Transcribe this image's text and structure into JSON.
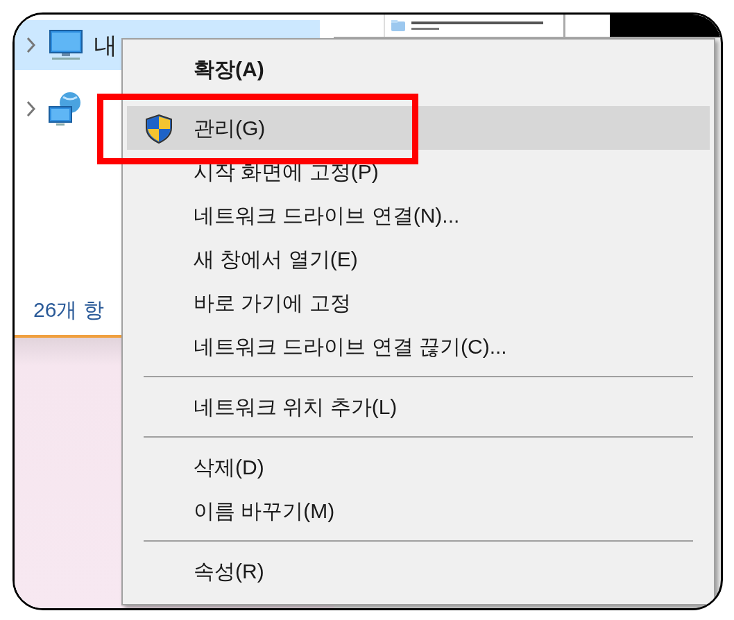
{
  "tree": [
    {
      "kind": "computer",
      "label": "내",
      "expanded": false,
      "selected": true
    },
    {
      "kind": "network",
      "expanded": false,
      "selected": false
    }
  ],
  "status_bar": "26개 항",
  "context_menu": [
    {
      "kind": "item",
      "label": "확장(A)",
      "default": true,
      "selected": false,
      "annotated": false
    },
    {
      "kind": "elevated",
      "label": "관리(G)",
      "default": false,
      "selected": true,
      "annotated": true
    },
    {
      "kind": "item",
      "label": "시작 화면에 고정(P)",
      "default": false,
      "selected": false,
      "annotated": false
    },
    {
      "kind": "item",
      "label": "네트워크 드라이브 연결(N)...",
      "default": false,
      "selected": false,
      "annotated": false
    },
    {
      "kind": "item",
      "label": "새 창에서 열기(E)",
      "default": false,
      "selected": false,
      "annotated": false
    },
    {
      "kind": "item",
      "label": "바로 가기에 고정",
      "default": false,
      "selected": false,
      "annotated": false
    },
    {
      "kind": "item",
      "label": "네트워크 드라이브 연결 끊기(C)...",
      "default": false,
      "selected": false,
      "annotated": false
    },
    {
      "kind": "separator"
    },
    {
      "kind": "item",
      "label": "네트워크 위치 추가(L)",
      "default": false,
      "selected": false,
      "annotated": false
    },
    {
      "kind": "separator"
    },
    {
      "kind": "item",
      "label": "삭제(D)",
      "default": false,
      "selected": false,
      "annotated": false
    },
    {
      "kind": "item",
      "label": "이름 바꾸기(M)",
      "default": false,
      "selected": false,
      "annotated": false
    },
    {
      "kind": "separator"
    },
    {
      "kind": "item",
      "label": "속성(R)",
      "default": false,
      "selected": false,
      "annotated": false
    }
  ]
}
